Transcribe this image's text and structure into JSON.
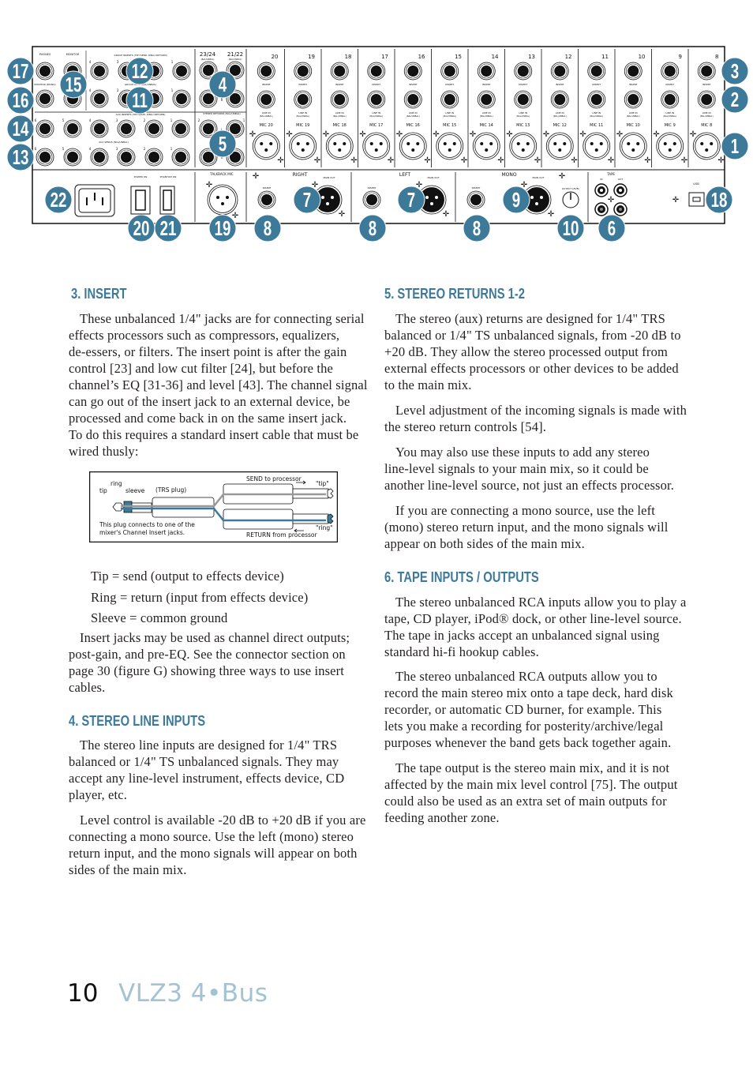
{
  "panel": {
    "colors": {
      "badge": "#3d7a9a",
      "line": "#111111"
    },
    "labels": {
      "phones": "PHONES",
      "monitor": "MONITOR",
      "monitor_mono": "MONITOR (MONO)",
      "group_inserts": "GROUP INSERTS (TIP=SEND, RING=RETURN)",
      "group_outs": "GROUP OUTS (BAL/UNBAL)",
      "ch2324": "23/24",
      "ch2122": "21/22",
      "bal_unbal": "(BAL/UNBAL)",
      "aux_inserts": "AUX INSERTS (TIP=SEND, RING=RETURN)",
      "aux_sends": "AUX SENDS (BAL/UNBAL)",
      "stereo_returns": "STEREO RETURNS (BAL/UNBAL)",
      "power": "POWER ON",
      "phantom": "PHANTOM ON",
      "talkback": "TALKBACK MIC",
      "right": "RIGHT",
      "left": "LEFT",
      "mono": "MONO",
      "main_out": "MAIN OUT",
      "insert": "INSERT",
      "line": "LINE",
      "line_in": "LINE IN",
      "output_level": "OUTPUT LEVEL",
      "tape": "TAPE",
      "tape_in": "IN",
      "tape_out": "OUT",
      "tape_l": "L",
      "usb": "USB",
      "l": "L",
      "r": "R"
    },
    "group_numbers": [
      "4",
      "3",
      "2",
      "1"
    ],
    "aux_numbers": [
      "6",
      "5",
      "4",
      "3",
      "2",
      "1"
    ],
    "return_numbers": [
      "2",
      "1"
    ],
    "channels": [
      "20",
      "19",
      "18",
      "17",
      "16",
      "15",
      "14",
      "13",
      "12",
      "11",
      "10",
      "9",
      "8"
    ],
    "mic_prefix": "MIC",
    "badges": [
      "17",
      "16",
      "14",
      "13",
      "15",
      "12",
      "11",
      "4",
      "5",
      "3",
      "2",
      "1",
      "22",
      "20",
      "21",
      "19",
      "8",
      "7",
      "8",
      "7",
      "8",
      "9",
      "10",
      "6",
      "18"
    ]
  },
  "left_column": {
    "insert": {
      "heading": "3. INSERT",
      "para1": [
        "These unbalanced 1/4\" jacks are for connecting serial",
        "effects processors such as compressors, equalizers,",
        "de-essers, or filters. The insert point is after the gain",
        "control [23] and low cut filter [24], but before the",
        "channel’s EQ [31-36] and level [43]. The channel signal",
        "can go out of the insert jack to an external device, be",
        "processed and come back in on the same insert jack.",
        "To do this requires a standard insert cable that must be",
        "wired thusly:"
      ],
      "diagram": {
        "tip": "tip",
        "ring": "ring",
        "sleeve": "sleeve",
        "plug": "(TRS plug)",
        "send": "SEND to processor",
        "return": "RETURN from processor",
        "tip_q": "\"tip\"",
        "ring_q": "\"ring\"",
        "note1": "This plug connects to one of the",
        "note2": "mixer's Channel Insert jacks."
      },
      "wiring": [
        "Tip = send (output to effects device)",
        "Ring = return (input from effects device)",
        "Sleeve = common ground"
      ],
      "para2": [
        "Insert jacks may be used as channel direct outputs;",
        "post-gain, and pre-EQ. See the connector section on",
        "page 30 (figure G) showing three ways to use insert",
        "cables."
      ]
    },
    "stereo_line": {
      "heading": "4. STEREO LINE INPUTS",
      "para1": [
        "The stereo line inputs are designed for 1/4\" TRS",
        "balanced or 1/4\" TS unbalanced signals. They may",
        "accept any line-level instrument, effects device, CD",
        "player, etc."
      ],
      "para2": [
        "Level control is available -20 dB to +20 dB if you are",
        "connecting a mono source. Use the left (mono) stereo",
        "return input, and the mono signals will appear on both",
        "sides of the main mix."
      ]
    }
  },
  "right_column": {
    "stereo_returns": {
      "heading": "5. STEREO RETURNS 1-2",
      "para1": [
        "The stereo (aux) returns are designed for 1/4\" TRS",
        "balanced or 1/4\" TS unbalanced signals, from -20 dB to",
        "+20 dB. They allow the stereo processed output from",
        "external effects processors or other devices to be added",
        "to the main mix."
      ],
      "para2": [
        "Level adjustment of the incoming signals is made with",
        "the stereo return controls [54]."
      ],
      "para3": [
        "You may also use these inputs to add any stereo",
        "line-level signals to your main mix, so it could be",
        "another line-level source, not just an effects processor."
      ],
      "para4": [
        "If you are connecting a mono source, use the left",
        "(mono) stereo return input, and the mono signals will",
        "appear on both sides of the main mix."
      ]
    },
    "tape": {
      "heading": "6. TAPE INPUTS / OUTPUTS",
      "para1": [
        "The stereo unbalanced RCA inputs allow you to play a",
        "tape, CD player, iPod® dock, or other line-level source.",
        "The tape in jacks accept an unbalanced signal using",
        "standard hi-fi hookup cables."
      ],
      "para2": [
        "The stereo unbalanced RCA outputs allow you to",
        "record the main stereo mix onto a tape deck, hard disk",
        "recorder, or automatic CD burner, for example. This",
        "lets you make a recording for posterity/archive/legal",
        "purposes whenever the band gets back together again."
      ],
      "para3": [
        "The tape output is the stereo main mix, and it is not",
        "affected by the main mix level control [75]. The output",
        "could also be used as an extra set of main outputs for",
        "feeding another zone."
      ]
    }
  },
  "footer": {
    "page_number": "10",
    "title": "VLZ3 4•Bus"
  }
}
